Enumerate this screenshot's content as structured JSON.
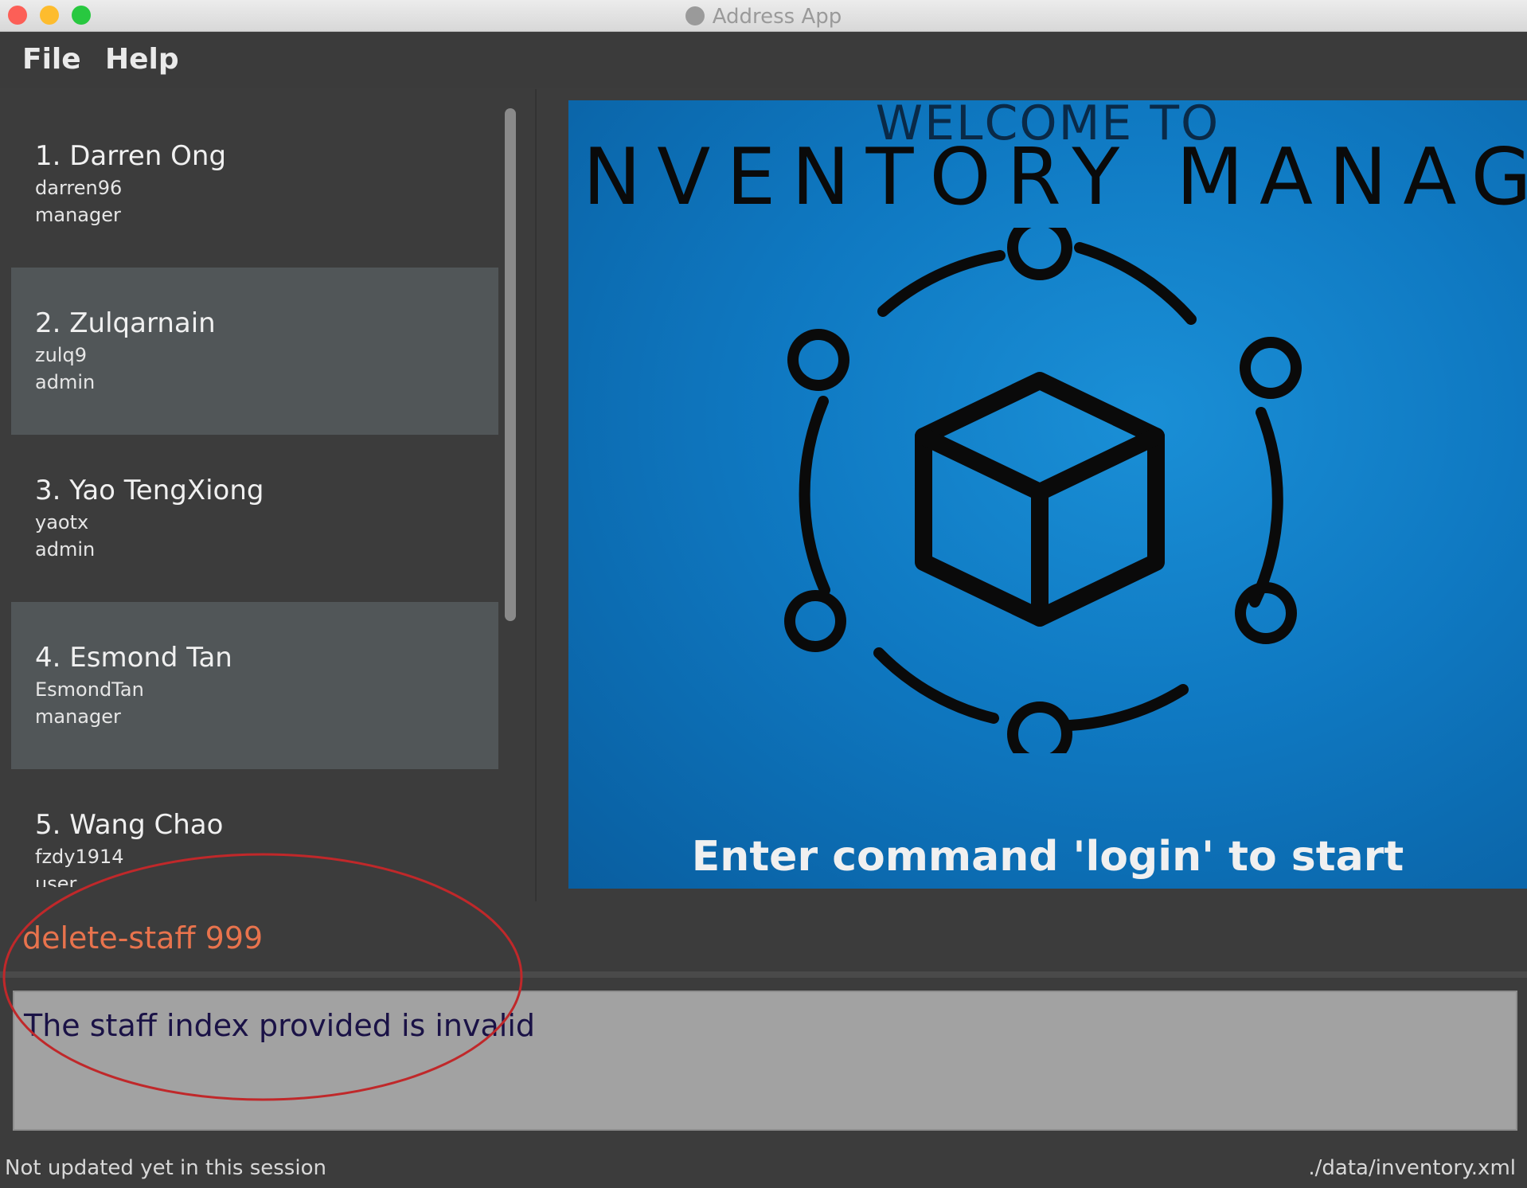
{
  "window": {
    "title": "Address App"
  },
  "menu": {
    "file_label": "File",
    "help_label": "Help"
  },
  "staff_list": [
    {
      "name": "1.  Darren Ong",
      "username": "darren96",
      "role": "manager"
    },
    {
      "name": "2.  Zulqarnain",
      "username": "zulq9",
      "role": "admin"
    },
    {
      "name": "3.  Yao TengXiong",
      "username": "yaotx",
      "role": "admin"
    },
    {
      "name": "4.  Esmond Tan",
      "username": "EsmondTan",
      "role": "manager"
    },
    {
      "name": "5.  Wang Chao",
      "username": "fzdy1914",
      "role": "user"
    }
  ],
  "welcome": {
    "subtitle": "WELCOME TO",
    "title": "NVENTORY MANAGER",
    "caption": "Enter command 'login' to start"
  },
  "command": {
    "value": "delete-staff 999"
  },
  "result": {
    "message": "The staff index provided is invalid"
  },
  "status": {
    "left": "Not updated yet in this session",
    "right": "./data/inventory.xml"
  },
  "colors": {
    "command_text": "#e8734d",
    "result_text": "#1a1246",
    "welcome_background": "#0f79c2",
    "annotation_stroke": "#c0282a"
  }
}
